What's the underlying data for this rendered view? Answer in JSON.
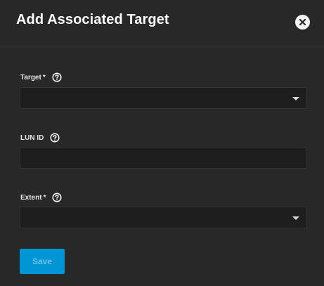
{
  "dialog": {
    "title": "Add Associated Target",
    "close_icon": "close-circle-icon"
  },
  "form": {
    "target": {
      "label": "Target",
      "required_mark": "*",
      "help_icon": "help-circle-icon",
      "value": ""
    },
    "lun_id": {
      "label": "LUN ID",
      "help_icon": "help-circle-icon",
      "value": ""
    },
    "extent": {
      "label": "Extent",
      "required_mark": "*",
      "help_icon": "help-circle-icon",
      "value": ""
    }
  },
  "actions": {
    "save_label": "Save",
    "save_enabled": false
  },
  "colors": {
    "background": "#282828",
    "field_background": "#1e1e1e",
    "accent": "#0095d5"
  }
}
